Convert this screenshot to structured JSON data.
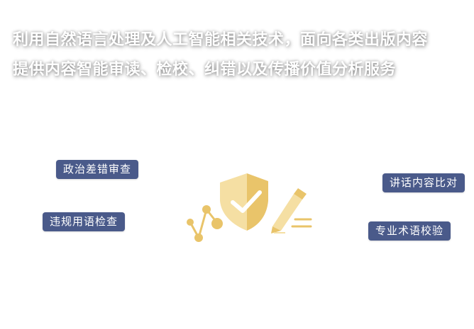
{
  "headline": {
    "line1": "利用自然语言处理及人工智能相关技术，面向各类出版内容",
    "line2": "提供内容智能审读、检校、纠错以及传播价值分析服务"
  },
  "tags": {
    "politics": "政治差错审查",
    "violation": "违规用语检查",
    "compare": "讲话内容比对",
    "terms": "专业术语校验"
  },
  "colors": {
    "tag_bg": "#4a5a8a",
    "gold": "#e9c46a",
    "gold_light": "#f5dfa3"
  },
  "icons": [
    "network-nodes-icon",
    "shield-check-icon",
    "pen-edit-icon"
  ]
}
